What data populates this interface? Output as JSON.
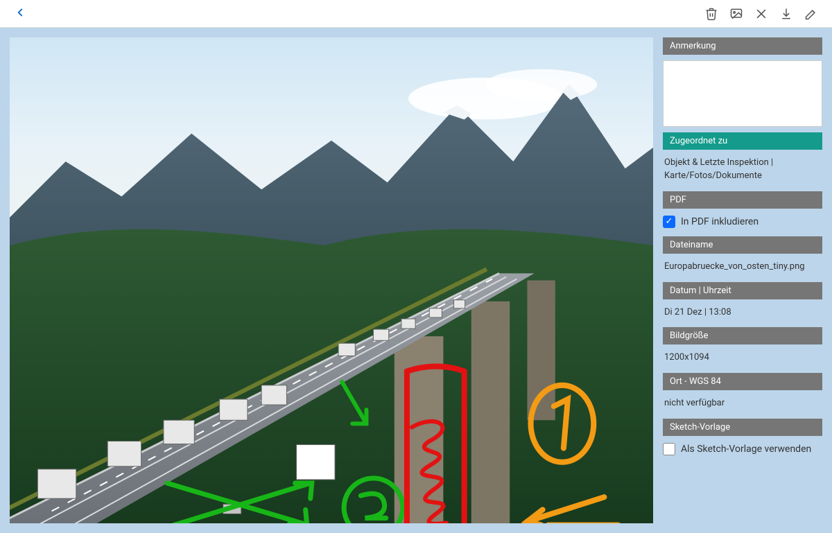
{
  "sidebar": {
    "annotation_header": "Anmerkung",
    "annotation_value": "",
    "assigned_header": "Zugeordnet zu",
    "assigned_text": "Objekt & Letzte Inspektion | Karte/Fotos/Dokumente",
    "pdf_header": "PDF",
    "pdf_checkbox_label": "In PDF inkludieren",
    "pdf_checked": true,
    "filename_header": "Dateiname",
    "filename_value": "Europabruecke_von_osten_tiny.png",
    "datetime_header": "Datum | Uhrzeit",
    "datetime_value": "Di 21 Dez | 13:08",
    "imagesize_header": "Bildgröße",
    "imagesize_value": "1200x1094",
    "location_header": "Ort - WGS 84",
    "location_value": "nicht verfügbar",
    "sketch_header": "Sketch-Vorlage",
    "sketch_checkbox_label": "Als Sketch-Vorlage verwenden",
    "sketch_checked": false
  }
}
